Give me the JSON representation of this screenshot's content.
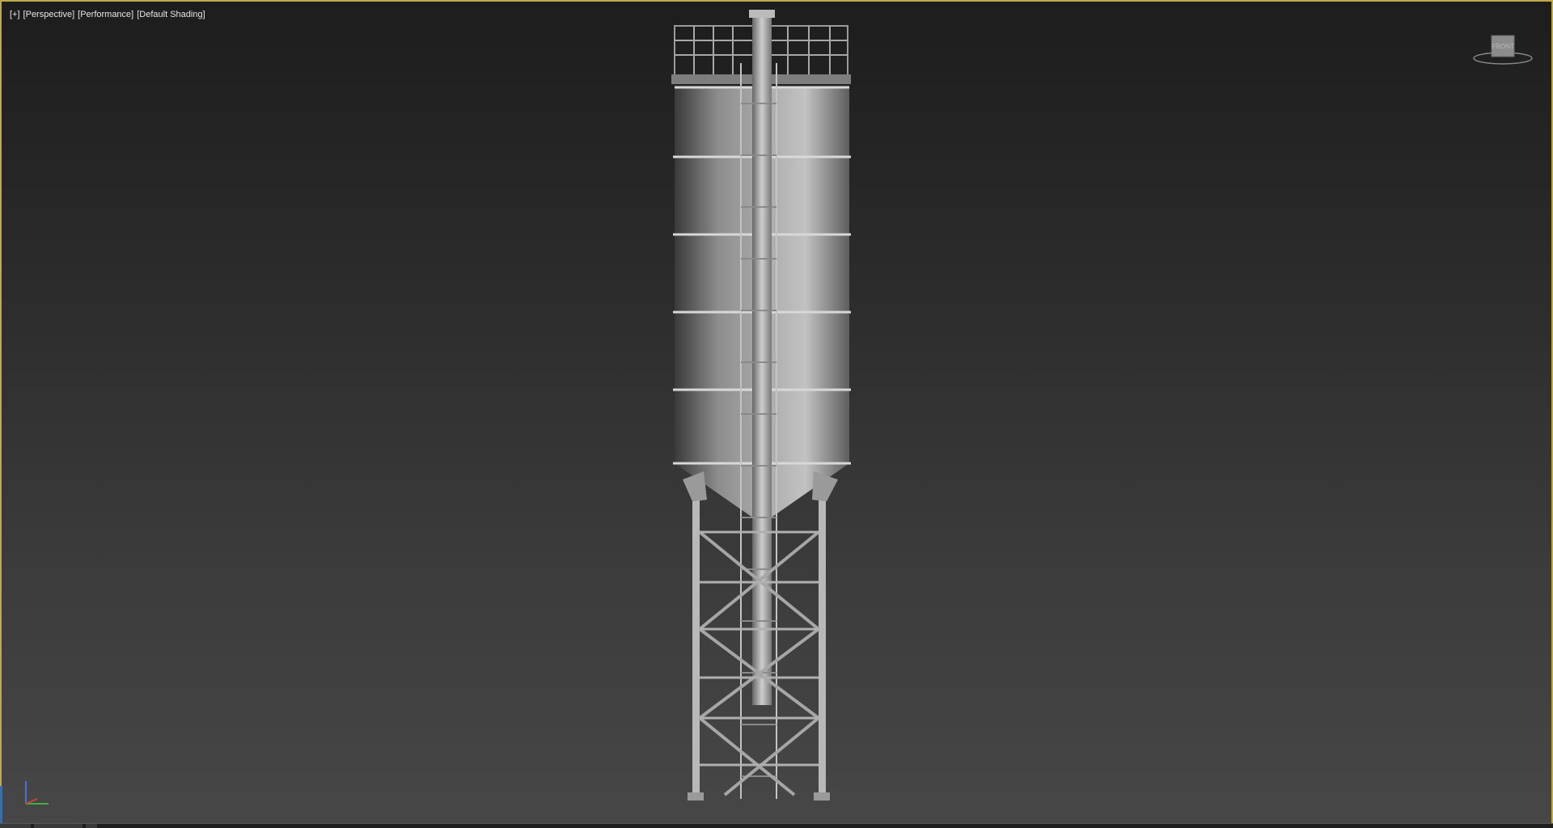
{
  "viewport": {
    "labels": [
      "[+]",
      "[Perspective]",
      "[Performance]",
      "[Default Shading]"
    ],
    "active_border_color": "#bfa948",
    "viewcube": {
      "face_label": "FRONT"
    },
    "axis_tripod": {
      "x_color": "#d04040",
      "y_color": "#40b040",
      "z_color": "#4a70d0"
    }
  },
  "scene": {
    "object": "silo-model"
  }
}
